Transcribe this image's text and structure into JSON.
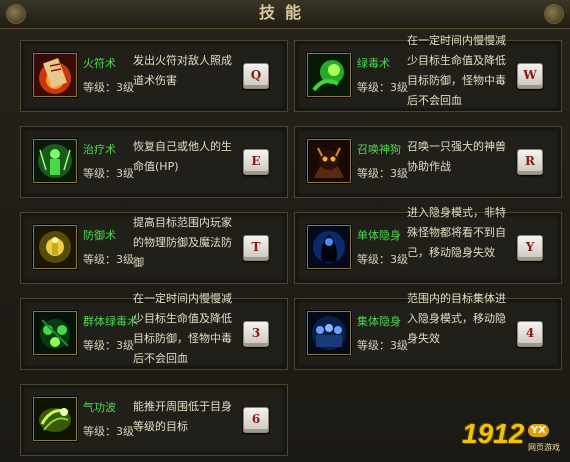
{
  "window": {
    "title": "技能"
  },
  "skills": [
    {
      "name": "火符术",
      "level": "等级：3级",
      "desc": "发出火符对敌人照成道术伤害",
      "key": "Q",
      "icon": "fire-talisman-icon"
    },
    {
      "name": "绿毒术",
      "level": "等级：3级",
      "desc": "在一定时间内慢慢减少目标生命值及降低目标防御，怪物中毒后不会回血",
      "key": "W",
      "icon": "green-poison-icon"
    },
    {
      "name": "治疗术",
      "level": "等级：3级",
      "desc": "恢复自己或他人的生命值(HP)",
      "key": "E",
      "icon": "healing-icon"
    },
    {
      "name": "召唤神狗",
      "level": "等级：3级",
      "desc": "召唤一只强大的神兽协助作战",
      "key": "R",
      "icon": "summon-beast-icon"
    },
    {
      "name": "防御术",
      "level": "等级：3级",
      "desc": "提高目标范围内玩家的物理防御及魔法防御",
      "key": "T",
      "icon": "defense-icon"
    },
    {
      "name": "单体隐身",
      "level": "等级：3级",
      "desc": "进入隐身模式，非特殊怪物都将看不到自己，移动隐身失效",
      "key": "Y",
      "icon": "single-stealth-icon"
    },
    {
      "name": "群体绿毒术",
      "level": "等级：3级",
      "desc": "在一定时间内慢慢减少目标生命值及降低目标防御，怪物中毒后不会回血",
      "key": "3",
      "icon": "group-poison-icon"
    },
    {
      "name": "集体隐身",
      "level": "等级：3级",
      "desc": "范围内的目标集体进入隐身模式，移动隐身失效",
      "key": "4",
      "icon": "group-stealth-icon"
    },
    {
      "name": "气功波",
      "level": "等级：3级",
      "desc": "能推开周围低于目身等级的目标",
      "key": "6",
      "icon": "qigong-wave-icon"
    }
  ],
  "watermark": {
    "number": "1912",
    "badge": "YX",
    "sub": "网页游戏"
  }
}
